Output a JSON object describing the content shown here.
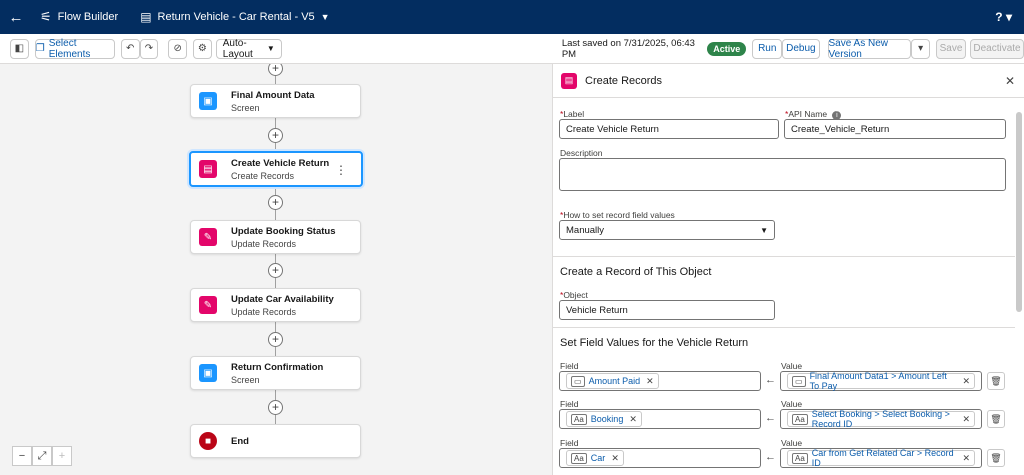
{
  "topbar": {
    "back_icon": "←",
    "app_label": "Flow Builder",
    "flow_name": "Return Vehicle - Car Rental - V5",
    "help_label": "?"
  },
  "toolbar": {
    "select_elements": "Select Elements",
    "layout_value": "Auto-Layout",
    "last_saved": "Last saved on 7/31/2025, 06:43 PM",
    "status_badge": "Active",
    "run": "Run",
    "debug": "Debug",
    "save_as_new": "Save As New Version",
    "save": "Save",
    "deactivate": "Deactivate"
  },
  "canvas": {
    "nodes": [
      {
        "title": "Final Amount Data",
        "subtitle": "Screen",
        "icon": "screen-icon",
        "color": "#1b96ff"
      },
      {
        "title": "Create Vehicle Return",
        "subtitle": "Create Records",
        "icon": "create-records-icon",
        "color": "#e3066a"
      },
      {
        "title": "Update Booking Status",
        "subtitle": "Update Records",
        "icon": "update-records-icon",
        "color": "#e3066a"
      },
      {
        "title": "Update Car Availability",
        "subtitle": "Update Records",
        "icon": "update-records-icon",
        "color": "#e3066a"
      },
      {
        "title": "Return Confirmation",
        "subtitle": "Screen",
        "icon": "screen-icon",
        "color": "#1b96ff"
      },
      {
        "title": "End",
        "subtitle": "",
        "icon": "end-icon",
        "color": "#ba0517"
      }
    ]
  },
  "panel": {
    "title": "Create Records",
    "label_label": "Label",
    "label_value": "Create Vehicle Return",
    "api_label": "API Name",
    "api_value": "Create_Vehicle_Return",
    "description_label": "Description",
    "description_value": "",
    "how_label": "How to set record field values",
    "how_value": "Manually",
    "create_section": "Create a Record of This Object",
    "object_label": "Object",
    "object_value": "Vehicle Return",
    "fields_section": "Set Field Values for the Vehicle Return",
    "field_label": "Field",
    "value_label": "Value",
    "mappings": [
      {
        "field": "Amount Paid",
        "field_icon": "▭",
        "value": "Final Amount Data1 > Amount Left To Pay",
        "value_icon": "▭"
      },
      {
        "field": "Booking",
        "field_icon": "Aa",
        "value": "Select Booking > Select Booking > Record ID",
        "value_icon": "Aa"
      },
      {
        "field": "Car",
        "field_icon": "Aa",
        "value": "Car from Get Related Car > Record ID",
        "value_icon": "Aa"
      }
    ]
  }
}
